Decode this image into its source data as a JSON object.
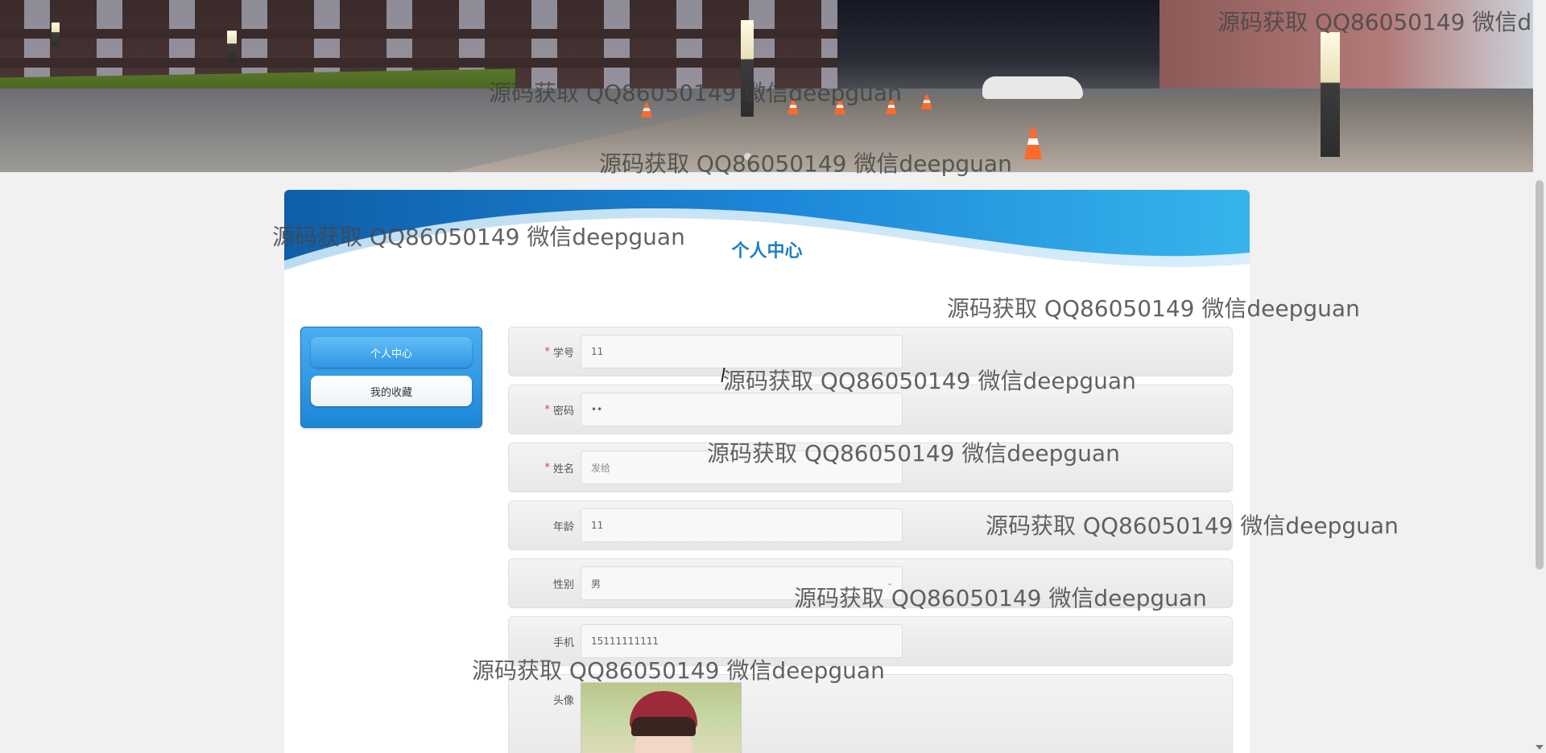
{
  "page": {
    "title": "个人中心"
  },
  "menu": {
    "items": [
      {
        "label": "个人中心",
        "active": true
      },
      {
        "label": "我的收藏",
        "active": false
      }
    ]
  },
  "form": {
    "fields": {
      "student_no": {
        "label": "学号",
        "value": "11",
        "required": true
      },
      "password": {
        "label": "密码",
        "value": "••",
        "required": true
      },
      "name": {
        "label": "姓名",
        "value": "发给",
        "required": true
      },
      "age": {
        "label": "年龄",
        "value": "11",
        "required": false
      },
      "gender": {
        "label": "性别",
        "value": "男",
        "required": false,
        "icon": "chevron-down-icon"
      },
      "phone": {
        "label": "手机",
        "value": "15111111111",
        "required": false
      },
      "avatar": {
        "label": "头像"
      }
    }
  },
  "watermark": {
    "text": "源码获取 QQ86050149 微信deepguan",
    "text_cut": "源码获取 QQ86050149 微信d"
  },
  "colors": {
    "accent": "#1f7fbf",
    "required": "#e23b3b",
    "menu_active": "#2f95e4"
  }
}
